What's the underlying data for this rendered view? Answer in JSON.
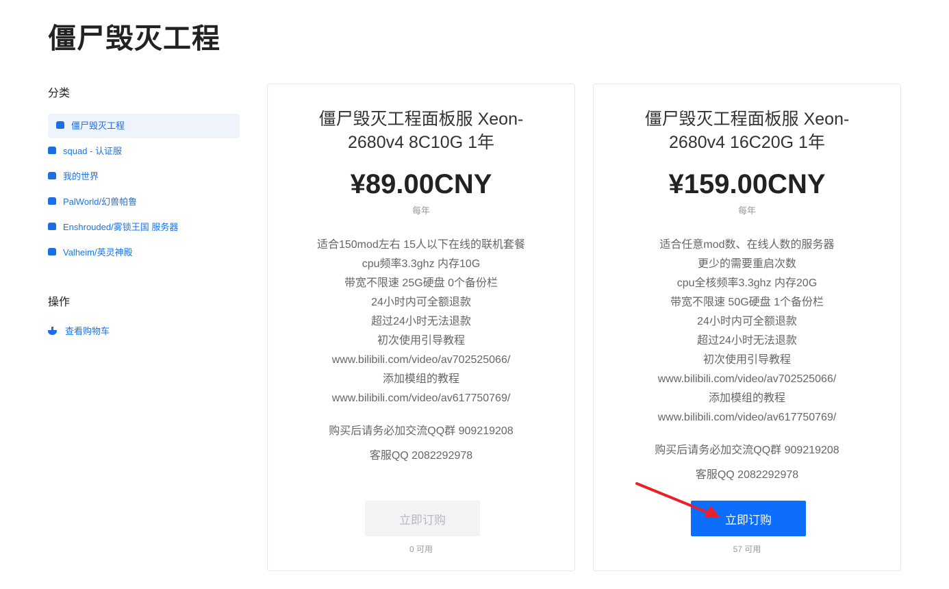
{
  "page_title": "僵尸毁灭工程",
  "sidebar": {
    "categories_title": "分类",
    "categories": [
      {
        "label": "僵尸毁灭工程",
        "icon": "box-icon",
        "active": true
      },
      {
        "label": "squad - 认证服",
        "icon": "box-icon"
      },
      {
        "label": "我的世界",
        "icon": "box-icon"
      },
      {
        "label": "PalWorld/幻兽帕鲁",
        "icon": "box-icon"
      },
      {
        "label": "Enshrouded/雾锁王国 服务器",
        "icon": "box-icon"
      },
      {
        "label": "Valheim/英灵神殿",
        "icon": "box-icon"
      }
    ],
    "actions_title": "操作",
    "actions": [
      {
        "label": "查看购物车",
        "icon": "basket-icon"
      }
    ]
  },
  "products": [
    {
      "title": "僵尸毁灭工程面板服 Xeon-2680v4 8C10G 1年",
      "price": "¥89.00CNY",
      "cycle": "每年",
      "description": [
        "适合150mod左右 15人以下在线的联机套餐",
        "cpu频率3.3ghz 内存10G",
        "带宽不限速 25G硬盘 0个备份栏",
        "24小时内可全额退款",
        "超过24小时无法退款",
        "初次使用引导教程",
        "www.bilibili.com/video/av702525066/",
        "添加模组的教程",
        "www.bilibili.com/video/av617750769/"
      ],
      "notes": [
        "购买后请务必加交流QQ群 909219208",
        "客服QQ 2082292978"
      ],
      "button_label": "立即订购",
      "button_enabled": false,
      "available": "0 可用"
    },
    {
      "title": "僵尸毁灭工程面板服 Xeon-2680v4 16C20G 1年",
      "price": "¥159.00CNY",
      "cycle": "每年",
      "description": [
        "适合任意mod数、在线人数的服务器",
        "更少的需要重启次数",
        "cpu全核频率3.3ghz 内存20G",
        "带宽不限速 50G硬盘 1个备份栏",
        "24小时内可全额退款",
        "超过24小时无法退款",
        "初次使用引导教程",
        "www.bilibili.com/video/av702525066/",
        "添加模组的教程",
        "www.bilibili.com/video/av617750769/"
      ],
      "notes": [
        "购买后请务必加交流QQ群 909219208",
        "客服QQ 2082292978"
      ],
      "button_label": "立即订购",
      "button_enabled": true,
      "available": "57 可用"
    }
  ],
  "colors": {
    "accent": "#0d6efd",
    "link": "#1a73e8",
    "annotation_arrow": "#e8202a"
  }
}
